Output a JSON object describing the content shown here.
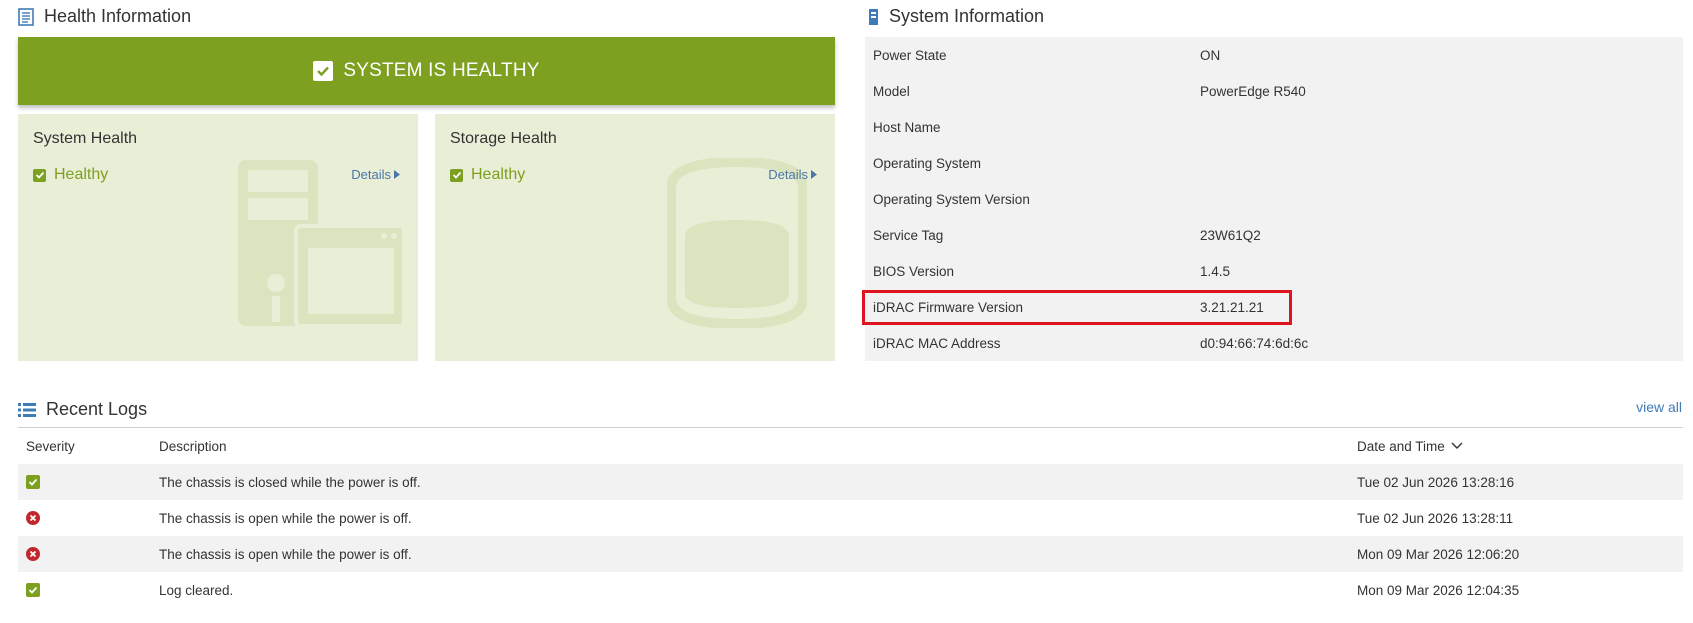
{
  "health": {
    "title": "Health Information",
    "banner": "SYSTEM IS HEALTHY",
    "cards": [
      {
        "title": "System Health",
        "status": "Healthy",
        "details": "Details"
      },
      {
        "title": "Storage Health",
        "status": "Healthy",
        "details": "Details"
      }
    ]
  },
  "system": {
    "title": "System Information",
    "rows": [
      {
        "key": "Power State",
        "value": "ON"
      },
      {
        "key": "Model",
        "value": "PowerEdge R540"
      },
      {
        "key": "Host Name",
        "value": ""
      },
      {
        "key": "Operating System",
        "value": ""
      },
      {
        "key": "Operating System Version",
        "value": ""
      },
      {
        "key": "Service Tag",
        "value": "23W61Q2"
      },
      {
        "key": "BIOS Version",
        "value": "1.4.5"
      },
      {
        "key": "iDRAC Firmware Version",
        "value": "3.21.21.21"
      },
      {
        "key": "iDRAC MAC Address",
        "value": "d0:94:66:74:6d:6c"
      }
    ]
  },
  "logs": {
    "title": "Recent Logs",
    "view_all": "view all",
    "columns": {
      "severity": "Severity",
      "description": "Description",
      "datetime": "Date and Time"
    },
    "rows": [
      {
        "severity": "ok",
        "description": "The chassis is closed while the power is off.",
        "datetime": "Tue 02 Jun 2026 13:28:16"
      },
      {
        "severity": "error",
        "description": "The chassis is open while the power is off.",
        "datetime": "Tue 02 Jun 2026 13:28:11"
      },
      {
        "severity": "error",
        "description": "The chassis is open while the power is off.",
        "datetime": "Mon 09 Mar 2026 12:06:20"
      },
      {
        "severity": "ok",
        "description": "Log cleared.",
        "datetime": "Mon 09 Mar 2026 12:04:35"
      }
    ]
  },
  "colors": {
    "healthy": "#7ea020",
    "critical": "#c0282d",
    "link": "#3f7cb7",
    "highlight": "#e0141e"
  }
}
